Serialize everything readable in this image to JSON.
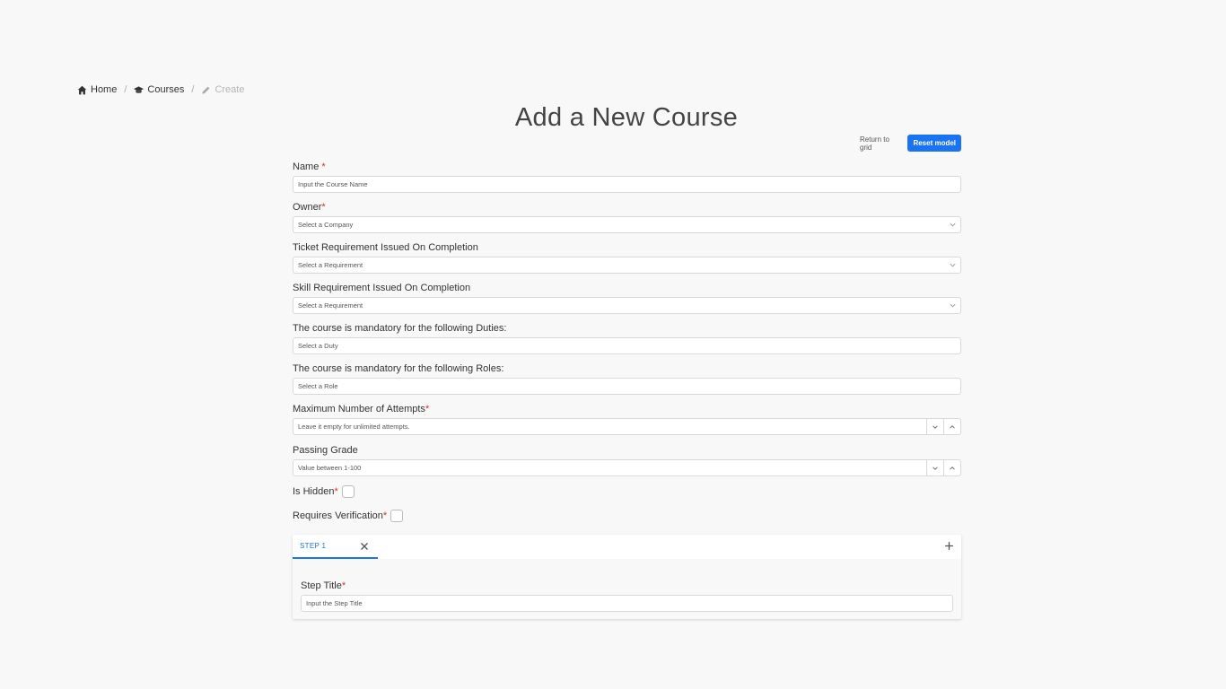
{
  "breadcrumb": {
    "home": "Home",
    "courses": "Courses",
    "create": "Create",
    "separator": "/"
  },
  "page_title": "Add a New Course",
  "actions": {
    "return_label": "Return to grid",
    "reset_label": "Reset model"
  },
  "form": {
    "name": {
      "label": "Name",
      "required": "*",
      "placeholder": "Input the Course Name"
    },
    "owner": {
      "label": "Owner",
      "required": "*",
      "value": "Select a Company"
    },
    "ticket": {
      "label": "Ticket Requirement Issued On Completion",
      "value": "Select a Requirement"
    },
    "skill": {
      "label": "Skill Requirement Issued On Completion",
      "value": "Select a Requirement"
    },
    "duties": {
      "label": "The course is mandatory for the following Duties:",
      "value": "Select a Duty"
    },
    "roles": {
      "label": "The course is mandatory for the following Roles:",
      "value": "Select a Role"
    },
    "attempts": {
      "label": "Maximum Number of Attempts",
      "required": "*",
      "placeholder": "Leave it empty for unlimited attempts."
    },
    "grade": {
      "label": "Passing Grade",
      "placeholder": "Value between 1-100"
    },
    "hidden": {
      "label": "Is Hidden",
      "required": "*"
    },
    "verification": {
      "label": "Requires Verification",
      "required": "*"
    }
  },
  "steps": {
    "tab_label": "STEP 1",
    "step_title": {
      "label": "Step Title",
      "required": "*",
      "placeholder": "Input the Step Title"
    }
  },
  "colors": {
    "accent": "#1a73f0",
    "required": "#d32f2f"
  }
}
